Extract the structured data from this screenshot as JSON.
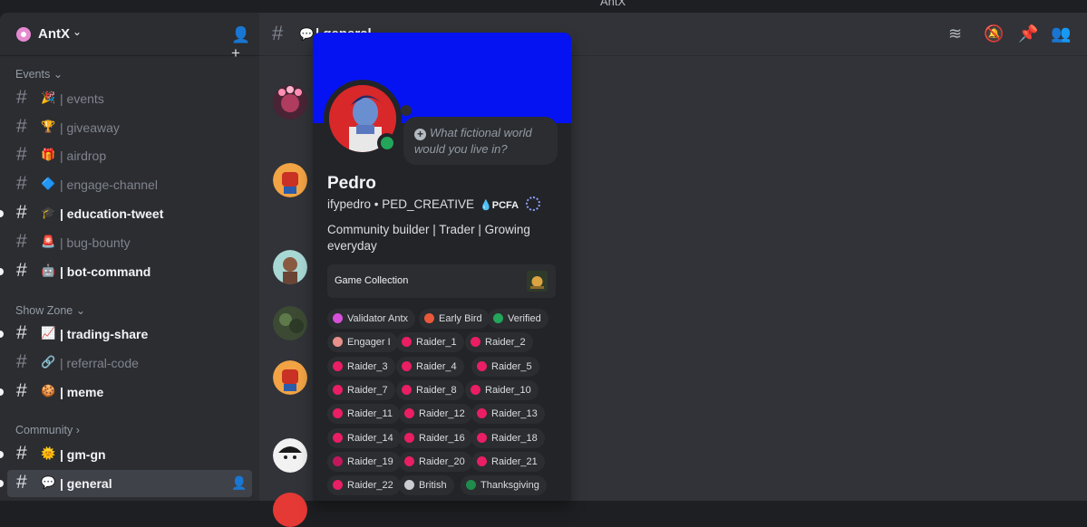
{
  "window": {
    "title": "AntX"
  },
  "server": {
    "name": "AntX"
  },
  "categories": {
    "events": "Events",
    "show_zone": "Show Zone",
    "community": "Community"
  },
  "channels": [
    {
      "emoji": "🎉",
      "name": "| events"
    },
    {
      "emoji": "🏆",
      "name": "| giveaway"
    },
    {
      "emoji": "🎁",
      "name": "| airdrop"
    },
    {
      "emoji": "🔷",
      "name": "| engage-channel"
    },
    {
      "emoji": "🎓",
      "name": "| education-tweet"
    },
    {
      "emoji": "🚨",
      "name": "| bug-bounty"
    },
    {
      "emoji": "🤖",
      "name": "| bot-command"
    },
    {
      "emoji": "📈",
      "name": "| trading-share"
    },
    {
      "emoji": "🔗",
      "name": "| referral-code"
    },
    {
      "emoji": "🍪",
      "name": "| meme"
    },
    {
      "emoji": "🌞",
      "name": "| gm-gn"
    },
    {
      "emoji": "💬",
      "name": "| general"
    }
  ],
  "header": {
    "emoji": "💬",
    "title": "| general"
  },
  "profile": {
    "note_placeholder": "What fictional world would you live in?",
    "display_name": "Pedro",
    "username_line": "ifypedro • PED_CREATIVE",
    "tag": "PCFA",
    "bio": "Community builder | Trader | Growing everyday",
    "game_collection": "Game Collection",
    "roles": [
      {
        "name": "Validator Antx",
        "color": "#d84fd9"
      },
      {
        "name": "Early Bird",
        "color": "#e8593a"
      },
      {
        "name": "Verified",
        "color": "#23a55a"
      },
      {
        "name": "Engager I",
        "color": "#e8908a"
      },
      {
        "name": "Raider_1",
        "color": "#e91e63"
      },
      {
        "name": "Raider_2",
        "color": "#e91e63"
      },
      {
        "name": "Raider_3",
        "color": "#e91e63"
      },
      {
        "name": "Raider_4",
        "color": "#e91e63"
      },
      {
        "name": "Raider_5",
        "color": "#e91e63"
      },
      {
        "name": "Raider_7",
        "color": "#e91e63"
      },
      {
        "name": "Raider_8",
        "color": "#e91e63"
      },
      {
        "name": "Raider_10",
        "color": "#e91e63"
      },
      {
        "name": "Raider_11",
        "color": "#e91e63"
      },
      {
        "name": "Raider_12",
        "color": "#e91e63"
      },
      {
        "name": "Raider_13",
        "color": "#e91e63"
      },
      {
        "name": "Raider_14",
        "color": "#e91e63"
      },
      {
        "name": "Raider_16",
        "color": "#e91e63"
      },
      {
        "name": "Raider_18",
        "color": "#e91e63"
      },
      {
        "name": "Raider_19",
        "color": "#c2185b"
      },
      {
        "name": "Raider_20",
        "color": "#e91e63"
      },
      {
        "name": "Raider_21",
        "color": "#e91e63"
      },
      {
        "name": "Raider_22",
        "color": "#e91e63"
      },
      {
        "name": "British",
        "color": "#c9ccd1"
      },
      {
        "name": "Thanksgiving",
        "color": "#1f8b4c"
      }
    ]
  }
}
